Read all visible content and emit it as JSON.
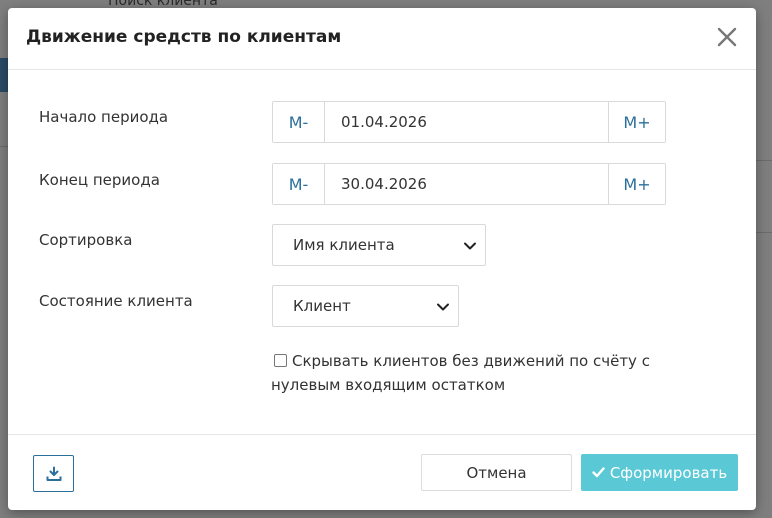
{
  "background": {
    "search_label": "Поиск клиента"
  },
  "modal": {
    "title": "Движение средств по клиентам",
    "fields": {
      "period_start": {
        "label": "Начало периода",
        "minus_label": "M-",
        "value": "01.04.2026",
        "plus_label": "M+"
      },
      "period_end": {
        "label": "Конец периода",
        "minus_label": "M-",
        "value": "30.04.2026",
        "plus_label": "M+"
      },
      "sort": {
        "label": "Сортировка",
        "selected": "Имя клиента"
      },
      "client_state": {
        "label": "Состояние клиента",
        "selected": "Клиент"
      },
      "hide_clients": {
        "label": "Скрывать клиентов без движений по счёту с нулевым входящим остатком",
        "checked": false
      }
    },
    "footer": {
      "cancel_label": "Отмена",
      "submit_label": "Сформировать"
    }
  },
  "icons": {
    "close": "close-icon",
    "download": "download-icon",
    "check": "check-icon",
    "chevron": "chevron-down-icon"
  },
  "colors": {
    "accent": "#2b6f9b",
    "submit_bg": "#5bc8d6",
    "overlay": "#7f7f7f"
  }
}
